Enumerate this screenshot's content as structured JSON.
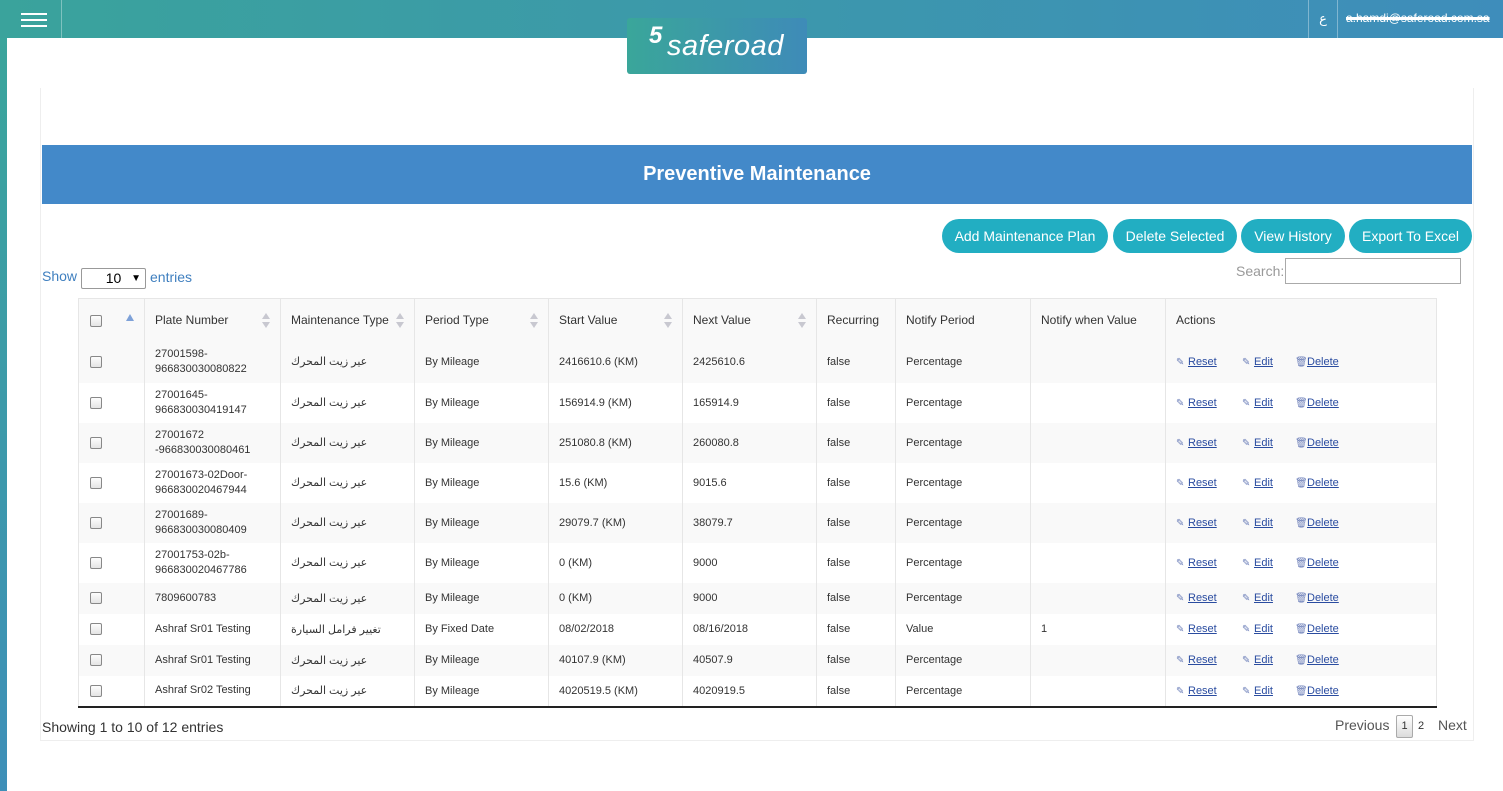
{
  "app": {
    "language_toggle": "ع",
    "user_email": "a.hamdi@saferoad.com.sa",
    "logo_mark": "5",
    "logo_text": "saferoad"
  },
  "page": {
    "title": "Preventive Maintenance"
  },
  "toolbar": {
    "add_label": "Add Maintenance Plan",
    "delete_label": "Delete Selected",
    "history_label": "View History",
    "export_label": "Export To Excel"
  },
  "length": {
    "show_label": "Show",
    "value": "10",
    "entries_label": "entries"
  },
  "search": {
    "label": "Search:",
    "value": ""
  },
  "table": {
    "headers": [
      "",
      "Plate Number",
      "Maintenance Type",
      "Period Type",
      "Start Value",
      "Next Value",
      "Recurring",
      "Notify Period",
      "Notify when Value",
      "Actions"
    ],
    "actions": {
      "reset": "Reset",
      "edit": "Edit",
      "delete": "Delete"
    },
    "rows": [
      {
        "plate": "27001598-966830030080822",
        "type": "عير زيت المحرك",
        "period": "By Mileage",
        "start": "2416610.6 (KM)",
        "next": "2425610.6",
        "recurring": "false",
        "notify_period": "Percentage",
        "notify_value": ""
      },
      {
        "plate": "27001645-966830030419147",
        "type": "عير زيت المحرك",
        "period": "By Mileage",
        "start": "156914.9 (KM)",
        "next": "165914.9",
        "recurring": "false",
        "notify_period": "Percentage",
        "notify_value": ""
      },
      {
        "plate": "27001672 -966830030080461",
        "type": "عير زيت المحرك",
        "period": "By Mileage",
        "start": "251080.8 (KM)",
        "next": "260080.8",
        "recurring": "false",
        "notify_period": "Percentage",
        "notify_value": ""
      },
      {
        "plate": "27001673-02Door-966830020467944",
        "type": "عير زيت المحرك",
        "period": "By Mileage",
        "start": "15.6 (KM)",
        "next": "9015.6",
        "recurring": "false",
        "notify_period": "Percentage",
        "notify_value": ""
      },
      {
        "plate": "27001689-966830030080409",
        "type": "عير زيت المحرك",
        "period": "By Mileage",
        "start": "29079.7 (KM)",
        "next": "38079.7",
        "recurring": "false",
        "notify_period": "Percentage",
        "notify_value": ""
      },
      {
        "plate": "27001753-02b-966830020467786",
        "type": "عير زيت المحرك",
        "period": "By Mileage",
        "start": "0 (KM)",
        "next": "9000",
        "recurring": "false",
        "notify_period": "Percentage",
        "notify_value": ""
      },
      {
        "plate": "7809600783",
        "type": "عير زيت المحرك",
        "period": "By Mileage",
        "start": "0 (KM)",
        "next": "9000",
        "recurring": "false",
        "notify_period": "Percentage",
        "notify_value": ""
      },
      {
        "plate": "Ashraf Sr01 Testing",
        "type": "تغيير فرامل السيارة",
        "period": "By Fixed Date",
        "start": "08/02/2018",
        "next": "08/16/2018",
        "recurring": "false",
        "notify_period": "Value",
        "notify_value": "1"
      },
      {
        "plate": "Ashraf Sr01 Testing",
        "type": "عير زيت المحرك",
        "period": "By Mileage",
        "start": "40107.9 (KM)",
        "next": "40507.9",
        "recurring": "false",
        "notify_period": "Percentage",
        "notify_value": ""
      },
      {
        "plate": "Ashraf Sr02 Testing",
        "type": "عير زيت المحرك",
        "period": "By Mileage",
        "start": "4020519.5 (KM)",
        "next": "4020919.5",
        "recurring": "false",
        "notify_period": "Percentage",
        "notify_value": ""
      }
    ]
  },
  "footer": {
    "info": "Showing 1 to 10 of 12 entries",
    "previous": "Previous",
    "pages": [
      "1",
      "2"
    ],
    "next": "Next"
  },
  "colors": {
    "header_band": "#4389c9",
    "button": "#22aec2",
    "topbar_start": "#3aa39c",
    "topbar_end": "#3e8dbb",
    "link": "#2a4ca0"
  }
}
